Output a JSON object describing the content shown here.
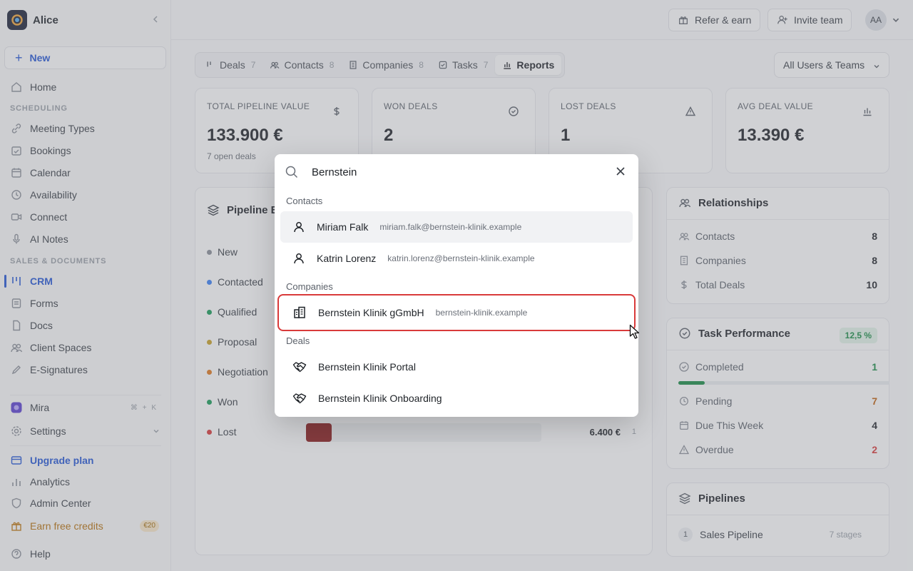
{
  "workspace": {
    "name": "Alice"
  },
  "sidebar": {
    "new_label": "New",
    "items": [
      {
        "label": "Home",
        "icon": "home-icon"
      },
      {
        "label": "Meeting Types",
        "icon": "link-icon"
      },
      {
        "label": "Bookings",
        "icon": "calendar-check-icon"
      },
      {
        "label": "Calendar",
        "icon": "calendar-icon"
      },
      {
        "label": "Availability",
        "icon": "clock-icon"
      },
      {
        "label": "Connect",
        "icon": "video-icon"
      },
      {
        "label": "AI Notes",
        "icon": "mic-icon"
      },
      {
        "label": "CRM",
        "icon": "kanban-icon"
      },
      {
        "label": "Forms",
        "icon": "form-icon"
      },
      {
        "label": "Docs",
        "icon": "doc-icon"
      },
      {
        "label": "Client Spaces",
        "icon": "users-icon"
      },
      {
        "label": "E-Signatures",
        "icon": "pen-icon"
      },
      {
        "label": "Mira",
        "icon": "mira-icon"
      },
      {
        "label": "Settings",
        "icon": "gear-icon"
      },
      {
        "label": "Upgrade plan",
        "icon": "card-icon"
      },
      {
        "label": "Analytics",
        "icon": "bar-chart-icon"
      },
      {
        "label": "Admin Center",
        "icon": "shield-icon"
      },
      {
        "label": "Earn free credits",
        "icon": "gift-icon"
      },
      {
        "label": "Help",
        "icon": "help-icon"
      }
    ],
    "sections": {
      "scheduling": "SCHEDULING",
      "sales": "SALES & DOCUMENTS"
    },
    "mira_shortcut": "⌘ + K",
    "credits_badge": "€20"
  },
  "header": {
    "refer_label": "Refer & earn",
    "invite_label": "Invite team",
    "avatar_initials": "AA"
  },
  "tabs": [
    {
      "label": "Deals",
      "count": "7"
    },
    {
      "label": "Contacts",
      "count": "8"
    },
    {
      "label": "Companies",
      "count": "8"
    },
    {
      "label": "Tasks",
      "count": "7"
    },
    {
      "label": "Reports",
      "count": ""
    }
  ],
  "filter": {
    "value": "All Users & Teams"
  },
  "stats": [
    {
      "label": "TOTAL PIPELINE VALUE",
      "value": "133.900 €",
      "sub": "7 open deals",
      "icon": "dollar-icon"
    },
    {
      "label": "WON DEALS",
      "value": "2",
      "sub": "",
      "icon": "check-circle-icon"
    },
    {
      "label": "LOST DEALS",
      "value": "1",
      "sub": "",
      "icon": "warning-icon"
    },
    {
      "label": "AVG DEAL VALUE",
      "value": "13.390 €",
      "sub": "",
      "icon": "chart-icon"
    }
  ],
  "pipeline": {
    "title": "Pipeline Br",
    "stages": [
      {
        "name": "New",
        "color": "#8a8f98"
      },
      {
        "name": "Contacted",
        "color": "#3b82f6"
      },
      {
        "name": "Qualified",
        "color": "#1a9d5a"
      },
      {
        "name": "Proposal",
        "color": "#c9a227"
      },
      {
        "name": "Negotiation",
        "color": "#e07a1f"
      },
      {
        "name": "Won",
        "color": "#1a9d5a"
      },
      {
        "name": "Lost",
        "color": "#d93a3a"
      }
    ],
    "lost_value": "6.400 €",
    "lost_count": "1"
  },
  "relationships": {
    "title": "Relationships",
    "rows": [
      {
        "label": "Contacts",
        "value": "8"
      },
      {
        "label": "Companies",
        "value": "8"
      },
      {
        "label": "Total Deals",
        "value": "10"
      }
    ]
  },
  "tasks": {
    "title": "Task Performance",
    "pct": "12,5 %",
    "progress": 0.125,
    "rows": [
      {
        "label": "Completed",
        "value": "1",
        "color": "#1a8d46"
      },
      {
        "label": "Pending",
        "value": "7",
        "color": "#c0620f"
      },
      {
        "label": "Due This Week",
        "value": "4",
        "color": "#1f2328"
      },
      {
        "label": "Overdue",
        "value": "2",
        "color": "#d93a3a"
      }
    ]
  },
  "pipelines": {
    "title": "Pipelines",
    "items": [
      {
        "num": "1",
        "name": "Sales Pipeline",
        "stages": "7 stages"
      }
    ]
  },
  "search": {
    "query": "Bernstein",
    "groups": {
      "contacts": "Contacts",
      "companies": "Companies",
      "deals": "Deals"
    },
    "contacts": [
      {
        "name": "Miriam Falk",
        "email": "miriam.falk@bernstein-klinik.example"
      },
      {
        "name": "Katrin Lorenz",
        "email": "katrin.lorenz@bernstein-klinik.example"
      }
    ],
    "companies": [
      {
        "name": "Bernstein Klinik gGmbH",
        "domain": "bernstein-klinik.example"
      }
    ],
    "deals": [
      {
        "name": "Bernstein Klinik Portal"
      },
      {
        "name": "Bernstein Klinik Onboarding"
      }
    ]
  }
}
